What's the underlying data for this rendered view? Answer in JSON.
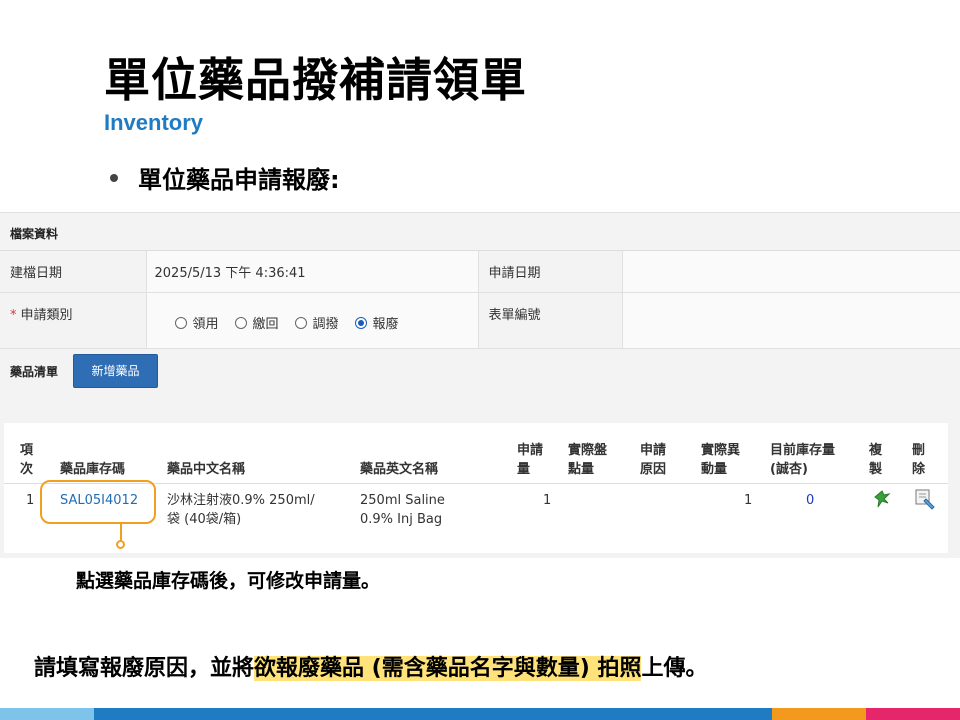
{
  "slide": {
    "title": "單位藥品撥補請領單",
    "subtitle": "Inventory",
    "bullet": "單位藥品申請報廢:"
  },
  "form": {
    "section_title": "檔案資料",
    "created_date_label": "建檔日期",
    "created_date_value": "2025/5/13 下午 4:36:41",
    "apply_date_label": "申請日期",
    "apply_date_value": "",
    "category_label": "申請類別",
    "form_no_label": "表單編號",
    "form_no_value": "",
    "options": [
      {
        "label": "領用",
        "checked": false
      },
      {
        "label": "繳回",
        "checked": false
      },
      {
        "label": "調撥",
        "checked": false
      },
      {
        "label": "報廢",
        "checked": true
      }
    ]
  },
  "drug_list": {
    "label": "藥品清單",
    "add_button": "新增藥品",
    "headers": {
      "item_1": "項",
      "item_2": "次",
      "code": "藥品庫存碼",
      "name_zh": "藥品中文名稱",
      "name_en": "藥品英文名稱",
      "req_qty_1": "申請",
      "req_qty_2": "量",
      "actual_1": "實際盤",
      "actual_2": "點量",
      "reason_1": "申請",
      "reason_2": "原因",
      "change_1": "實際異",
      "change_2": "動量",
      "stock_1": "目前庫存量",
      "stock_2": "(誠杏)",
      "copy_1": "複",
      "copy_2": "製",
      "del_1": "刪",
      "del_2": "除"
    },
    "rows": [
      {
        "no": "1",
        "code": "SAL05I4012",
        "name_zh_1": "沙林注射液0.9% 250ml/",
        "name_zh_2": "袋 (40袋/箱)",
        "name_en_1": "250ml Saline",
        "name_en_2": "0.9% Inj Bag",
        "req_qty": "1",
        "actual": "",
        "reason": "",
        "change": "1",
        "stock": "0"
      }
    ]
  },
  "annotation": "點選藥品庫存碼後，可修改申請量。",
  "instruction": {
    "part1": "請填寫報廢原因，並將",
    "part2": "欲報廢藥品 (需含藥品名字與數量) 拍照",
    "part3": "上傳。"
  },
  "colors": {
    "accent": "#1f7bc2",
    "button": "#2f6db5",
    "highlight": "#ffe27a",
    "callout": "#f0a020"
  }
}
